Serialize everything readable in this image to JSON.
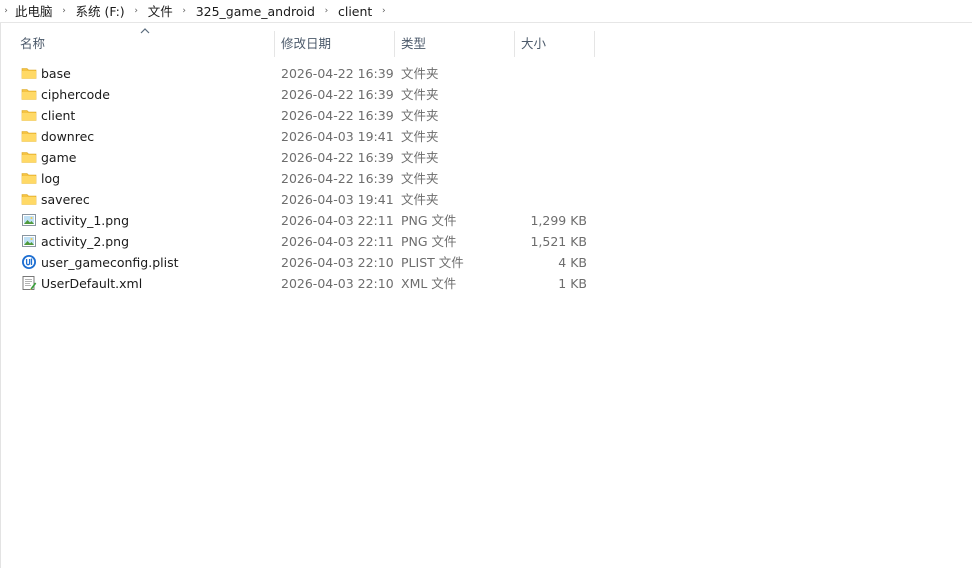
{
  "breadcrumb": {
    "items": [
      "此电脑",
      "系统 (F:)",
      "文件",
      "325_game_android",
      "client"
    ]
  },
  "columns": {
    "name": "名称",
    "date": "修改日期",
    "type": "类型",
    "size": "大小",
    "sort_indicator": "ascending"
  },
  "files": [
    {
      "name": "base",
      "date": "2026-04-22 16:39",
      "type": "文件夹",
      "size": "",
      "icon": "folder-icon"
    },
    {
      "name": "ciphercode",
      "date": "2026-04-22 16:39",
      "type": "文件夹",
      "size": "",
      "icon": "folder-icon"
    },
    {
      "name": "client",
      "date": "2026-04-22 16:39",
      "type": "文件夹",
      "size": "",
      "icon": "folder-icon"
    },
    {
      "name": "downrec",
      "date": "2026-04-03 19:41",
      "type": "文件夹",
      "size": "",
      "icon": "folder-icon"
    },
    {
      "name": "game",
      "date": "2026-04-22 16:39",
      "type": "文件夹",
      "size": "",
      "icon": "folder-icon"
    },
    {
      "name": "log",
      "date": "2026-04-22 16:39",
      "type": "文件夹",
      "size": "",
      "icon": "folder-icon"
    },
    {
      "name": "saverec",
      "date": "2026-04-03 19:41",
      "type": "文件夹",
      "size": "",
      "icon": "folder-icon"
    },
    {
      "name": "activity_1.png",
      "date": "2026-04-03 22:11",
      "type": "PNG 文件",
      "size": "1,299 KB",
      "icon": "image-file-icon"
    },
    {
      "name": "activity_2.png",
      "date": "2026-04-03 22:11",
      "type": "PNG 文件",
      "size": "1,521 KB",
      "icon": "image-file-icon"
    },
    {
      "name": "user_gameconfig.plist",
      "date": "2026-04-03 22:10",
      "type": "PLIST 文件",
      "size": "4 KB",
      "icon": "plist-file-icon"
    },
    {
      "name": "UserDefault.xml",
      "date": "2026-04-03 22:10",
      "type": "XML 文件",
      "size": "1 KB",
      "icon": "xml-file-icon"
    }
  ],
  "colors": {
    "folder": "#f5c343",
    "header_text": "#4c5a6b",
    "secondary_text": "#6d6d6d"
  }
}
